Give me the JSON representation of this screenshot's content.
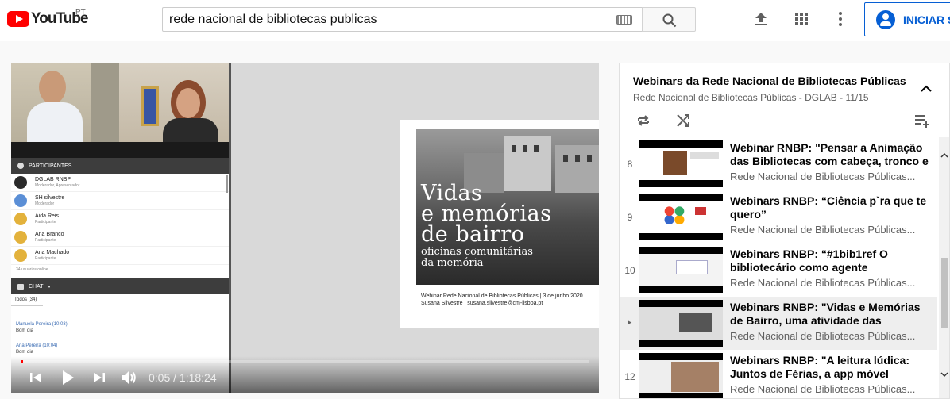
{
  "header": {
    "logo_text": "YouTube",
    "country_code": "PT",
    "search_value": "rede nacional de bibliotecas publicas",
    "signin_label": "INICIAR SESSÃO",
    "icons": [
      "upload-icon",
      "apps-icon",
      "more-vert-icon",
      "search-icon",
      "keyboard-icon",
      "account-icon"
    ]
  },
  "player": {
    "time_current": "0:05",
    "time_separator": " / ",
    "time_total": "1:18:24",
    "progress_fraction": 0.0011,
    "slide": {
      "title": "Vidas\ne memórias\nde bairro",
      "subtitle": "oficinas comunitárias\nda memória",
      "footer": "Webinar Rede Nacional de Bibliotecas Públicas | 3 de junho 2020\nSusana Silvestre | susana.silvestre@cm-lisboa.pt"
    },
    "participants": {
      "header": "PARTICIPANTES",
      "rows": [
        {
          "name": "DGLAB RNBP",
          "role": "Moderador, Apresentador",
          "color": "#2b2b2b"
        },
        {
          "name": "SH silvestre",
          "role": "Moderador",
          "color": "#5b8fd6"
        },
        {
          "name": "Aida Reis",
          "role": "Participante",
          "color": "#e3b23c"
        },
        {
          "name": "Ana Branco",
          "role": "Participante",
          "color": "#e3b23c"
        },
        {
          "name": "Ana Machado",
          "role": "Participante",
          "color": "#e3b23c"
        }
      ],
      "footer": "34 usuários online"
    },
    "chat": {
      "header": "CHAT",
      "tab": "Todos (34)",
      "messages": [
        {
          "who": "Manuela Pereira (10:03)",
          "text": "Bom dia"
        },
        {
          "who": "Ana Pereira (10:04)",
          "text": "Bom dia"
        }
      ]
    }
  },
  "playlist": {
    "title": "Webinars da Rede Nacional de Bibliotecas Públicas",
    "subtitle": "Rede Nacional de Bibliotecas Públicas - DGLAB - 11/15",
    "items": [
      {
        "index": "8",
        "title": "Webinar RNBP: \"Pensar a Animação das Bibliotecas com cabeça, tronco e",
        "channel": "Rede Nacional de Bibliotecas Públicas...",
        "active": false
      },
      {
        "index": "9",
        "title": "Webinars RNBP: “Ciência p`ra que te quero”",
        "channel": "Rede Nacional de Bibliotecas Públicas...",
        "active": false
      },
      {
        "index": "10",
        "title": "Webinars RNBP: “#1bib1ref O bibliotecário como agente",
        "channel": "Rede Nacional de Bibliotecas Públicas...",
        "active": false
      },
      {
        "index": "▸",
        "title": "Webinars RNBP: \"Vidas e Memórias de Bairro, uma atividade das",
        "channel": "Rede Nacional de Bibliotecas Públicas...",
        "active": true
      },
      {
        "index": "12",
        "title": "Webinars RNBP: \"A leitura lúdica: Juntos de Férias, a app móvel",
        "channel": "Rede Nacional de Bibliotecas Públicas...",
        "active": false
      }
    ]
  },
  "colors": {
    "brand_red": "#ff0000",
    "link_blue": "#065fd4",
    "active_row": "#eeeeee"
  }
}
